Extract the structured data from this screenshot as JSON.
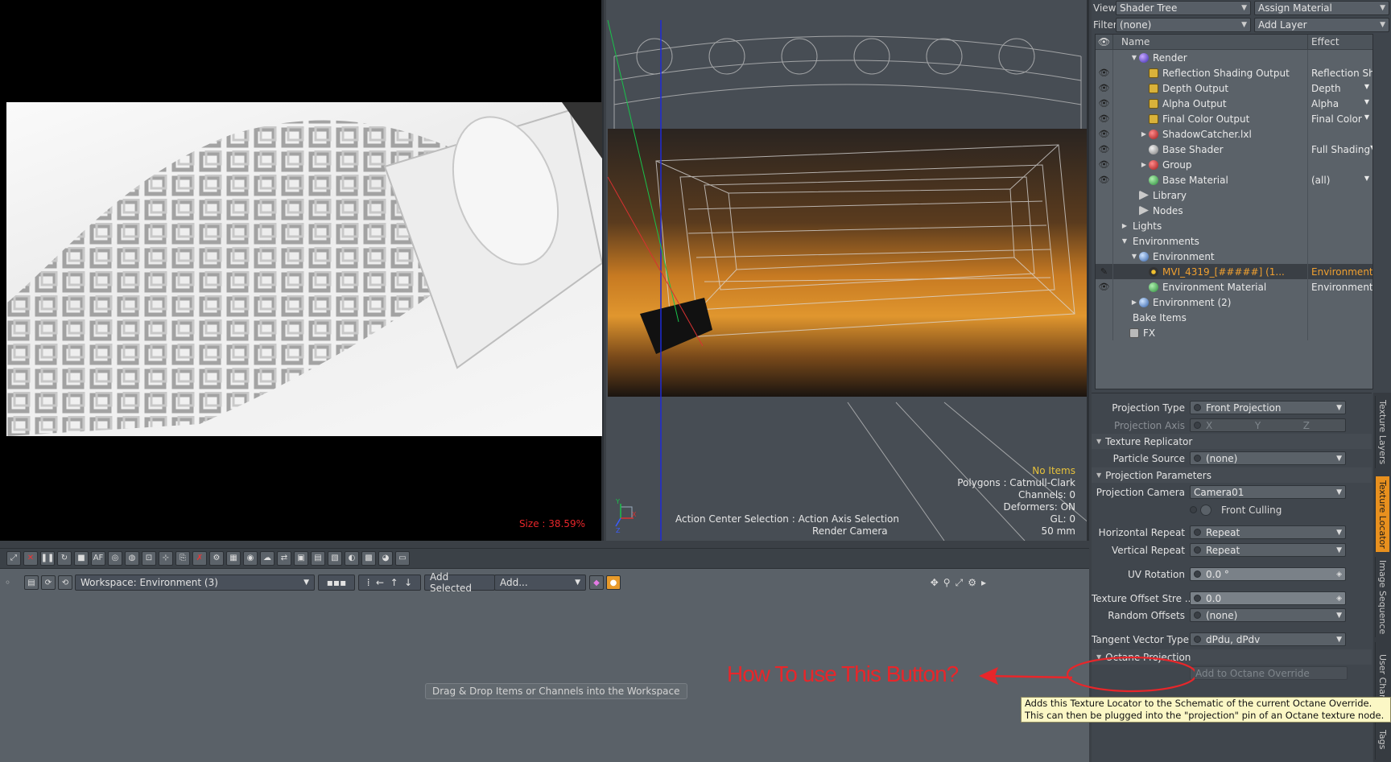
{
  "render_view": {
    "size_label": "Size : 38.59%"
  },
  "viewport": {
    "no_items": "No Items",
    "polygons": "Polygons : Catmull-Clark",
    "channels": "Channels: 0",
    "deformers": "Deformers: ON",
    "gl": "GL: 0",
    "focal": "50 mm",
    "action": "Action Center Selection : Action Axis Selection",
    "camera": "Render Camera",
    "axis_labels": [
      "Y",
      "X",
      "Z"
    ]
  },
  "right_panel": {
    "view_label": "View",
    "view_value": "Shader Tree",
    "assign_material": "Assign Material",
    "filter_label": "Filter",
    "filter_value": "(none)",
    "add_layer": "Add Layer",
    "columns": {
      "name": "Name",
      "effect": "Effect"
    },
    "tree": [
      {
        "name": "Render",
        "effect": "",
        "icon": "render-icon",
        "indent": 1,
        "twirl": "▼",
        "eye": false
      },
      {
        "name": "Reflection Shading Output",
        "effect": "Reflection Shadi ...",
        "icon": "output-icon",
        "indent": 2,
        "twirl": "",
        "eye": true
      },
      {
        "name": "Depth Output",
        "effect": "Depth",
        "icon": "output-icon",
        "indent": 2,
        "twirl": "",
        "eye": true
      },
      {
        "name": "Alpha Output",
        "effect": "Alpha",
        "icon": "output-icon",
        "indent": 2,
        "twirl": "",
        "eye": true
      },
      {
        "name": "Final Color Output",
        "effect": "Final Color",
        "icon": "output-icon",
        "indent": 2,
        "twirl": "",
        "eye": true
      },
      {
        "name": "ShadowCatcher.lxl",
        "effect": "",
        "icon": "material-red-icon",
        "indent": 2,
        "twirl": "▶",
        "eye": true
      },
      {
        "name": "Base Shader",
        "effect": "Full Shading",
        "icon": "shader-icon",
        "indent": 2,
        "twirl": "",
        "eye": true
      },
      {
        "name": "Group",
        "effect": "",
        "icon": "material-red-icon",
        "indent": 2,
        "twirl": "▶",
        "eye": true
      },
      {
        "name": "Base Material",
        "effect": "(all)",
        "icon": "material-green-icon",
        "indent": 2,
        "twirl": "",
        "eye": true
      },
      {
        "name": "Library",
        "effect": "",
        "icon": "folder-icon",
        "indent": 1,
        "twirl": "",
        "eye": false
      },
      {
        "name": "Nodes",
        "effect": "",
        "icon": "folder-icon",
        "indent": 1,
        "twirl": "",
        "eye": false
      },
      {
        "name": "Lights",
        "effect": "",
        "icon": "",
        "indent": 0,
        "twirl": "▶",
        "eye": false
      },
      {
        "name": "Environments",
        "effect": "",
        "icon": "",
        "indent": 0,
        "twirl": "▼",
        "eye": false
      },
      {
        "name": "Environment",
        "effect": "",
        "icon": "environment-icon",
        "indent": 1,
        "twirl": "▼",
        "eye": false
      },
      {
        "name": "MVI_4319_[#####] (1...",
        "effect": "Environment Col...",
        "icon": "texture-icon",
        "indent": 2,
        "twirl": "",
        "eye": false,
        "selected": true
      },
      {
        "name": "Environment Material",
        "effect": "Environment Col...",
        "icon": "material-green-icon",
        "indent": 2,
        "twirl": "",
        "eye": true
      },
      {
        "name": "Environment (2)",
        "effect": "",
        "icon": "environment-icon",
        "indent": 1,
        "twirl": "▶",
        "eye": false
      },
      {
        "name": "Bake Items",
        "effect": "",
        "icon": "",
        "indent": 0,
        "twirl": "",
        "eye": false
      },
      {
        "name": "FX",
        "effect": "",
        "icon": "film-icon",
        "indent": 0,
        "twirl": "",
        "eye": false
      }
    ],
    "props": {
      "projection_type_label": "Projection Type",
      "projection_type": "Front Projection",
      "projection_axis_label": "Projection Axis",
      "axis_x": "X",
      "axis_y": "Y",
      "axis_z": "Z",
      "texture_replicator": "Texture Replicator",
      "particle_source_label": "Particle Source",
      "particle_source": "(none)",
      "projection_parameters": "Projection Parameters",
      "projection_camera_label": "Projection Camera",
      "projection_camera": "Camera01",
      "front_culling": "Front Culling",
      "horizontal_repeat_label": "Horizontal Repeat",
      "horizontal_repeat": "Repeat",
      "vertical_repeat_label": "Vertical Repeat",
      "vertical_repeat": "Repeat",
      "uv_rotation_label": "UV Rotation",
      "uv_rotation": "0.0 °",
      "texture_offset_label": "Texture Offset Stre ...",
      "texture_offset": "0.0",
      "random_offsets_label": "Random Offsets",
      "random_offsets": "(none)",
      "tangent_vector_label": "Tangent Vector Type",
      "tangent_vector": "dPdu, dPdv",
      "octane_projection": "Octane Projection",
      "octane_button": "Add to Octane Override"
    },
    "side_tabs": [
      "Texture Layers",
      "Texture Locator",
      "Image Sequence",
      "User Chan",
      "Tags"
    ]
  },
  "workspace": {
    "workspace_select": "Workspace: Environment (3)",
    "add_selected": "Add Selected",
    "add_menu": "Add...",
    "hint": "Drag & Drop Items or Channels into the Workspace"
  },
  "annotation": {
    "text": "How To use This Button?",
    "tooltip": "Adds this Texture Locator to the Schematic of the current Octane Override.  This can then be plugged into the \"projection\" pin of an Octane texture node."
  },
  "colors": {
    "accent": "#e8901e",
    "annotation": "#e8262a",
    "tooltip_bg": "#fbf7c5"
  }
}
